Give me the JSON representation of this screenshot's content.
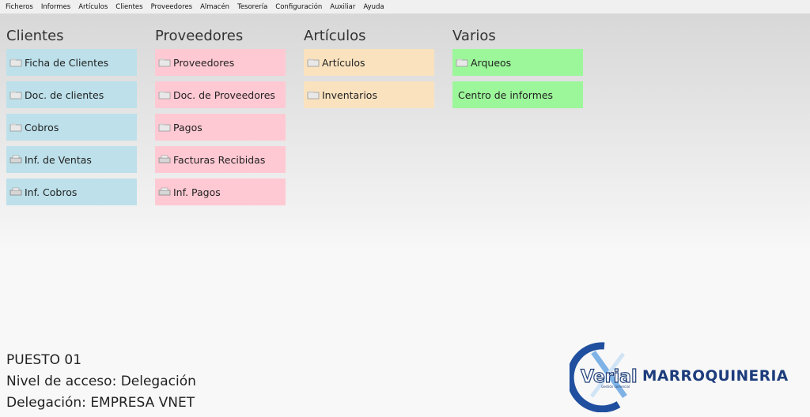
{
  "menu": [
    "Ficheros",
    "Informes",
    "Artículos",
    "Clientes",
    "Proveedores",
    "Almacén",
    "Tesorería",
    "Configuración",
    "Auxiliar",
    "Ayuda"
  ],
  "columns": [
    {
      "title": "Clientes",
      "color": "#bde0ea",
      "items": [
        "Ficha de Clientes",
        "Doc. de clientes",
        "Cobros",
        "Inf. de Ventas",
        "Inf. Cobros"
      ]
    },
    {
      "title": "Proveedores",
      "color": "#ffc9d3",
      "items": [
        "Proveedores",
        "Doc. de Proveedores",
        "Pagos",
        "Facturas Recibidas",
        "Inf. Pagos"
      ]
    },
    {
      "title": "Artículos",
      "color": "#fae2bf",
      "items": [
        "Artículos",
        "Inventarios"
      ]
    },
    {
      "title": "Varios",
      "color": "#9cf79a",
      "items": [
        "Arqueos",
        "Centro de informes"
      ]
    }
  ],
  "status": {
    "puesto": "PUESTO 01",
    "nivel": "Nivel de acceso: Delegación",
    "delegacion": "Delegación: EMPRESA VNET"
  },
  "logo": {
    "brand": "Verial",
    "tagline": "Gestión comercial",
    "company": "MARROQUINERIA"
  }
}
